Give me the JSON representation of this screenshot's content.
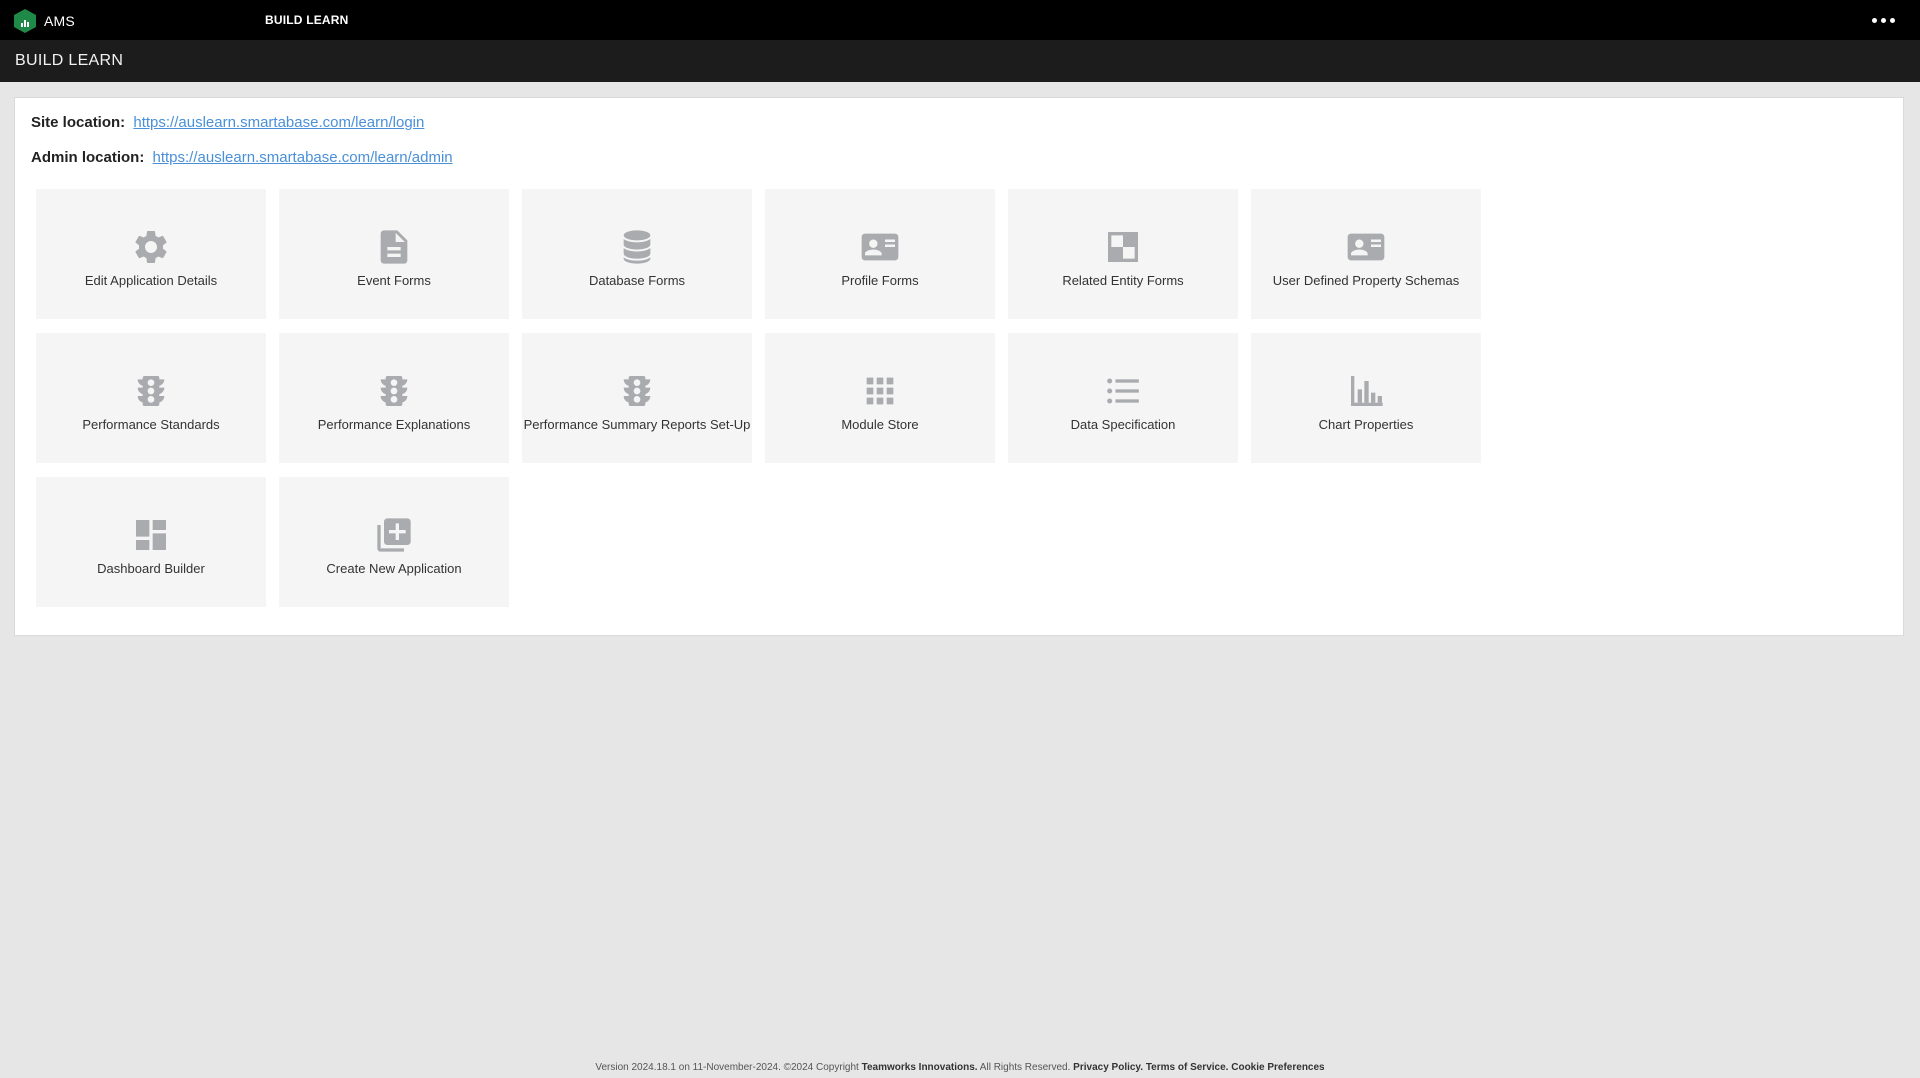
{
  "app": {
    "brand_name": "AMS",
    "top_title": "BUILD LEARN",
    "more_icon": "more-horizontal-icon"
  },
  "subheader": {
    "title": "BUILD LEARN"
  },
  "locations": {
    "site_label": "Site location:",
    "site_url": "https://auslearn.smartabase.com/learn/login",
    "admin_label": "Admin location:",
    "admin_url": "https://auslearn.smartabase.com/learn/admin"
  },
  "tiles": [
    {
      "label": "Edit Application Details",
      "icon": "gear-icon"
    },
    {
      "label": "Event Forms",
      "icon": "document-icon"
    },
    {
      "label": "Database Forms",
      "icon": "database-icon"
    },
    {
      "label": "Profile Forms",
      "icon": "id-card-icon"
    },
    {
      "label": "Related Entity Forms",
      "icon": "checker-icon"
    },
    {
      "label": "User Defined Property Schemas",
      "icon": "id-card-icon"
    },
    {
      "label": "Performance Standards",
      "icon": "traffic-light-icon"
    },
    {
      "label": "Performance Explanations",
      "icon": "traffic-light-icon"
    },
    {
      "label": "Performance Summary Reports Set-Up",
      "icon": "traffic-light-icon"
    },
    {
      "label": "Module Store",
      "icon": "grid-icon"
    },
    {
      "label": "Data Specification",
      "icon": "list-icon"
    },
    {
      "label": "Chart Properties",
      "icon": "bar-chart-icon"
    },
    {
      "label": "Dashboard Builder",
      "icon": "dashboard-icon"
    },
    {
      "label": "Create New Application",
      "icon": "add-library-icon"
    }
  ],
  "footer": {
    "version_text": "Version 2024.18.1 on 11-November-2024. ©2024 Copyright",
    "company": "Teamworks Innovations.",
    "rights": "All Rights Reserved.",
    "privacy": "Privacy Policy.",
    "terms": "Terms of Service.",
    "cookies": "Cookie Preferences"
  },
  "colors": {
    "topbar": "#000000",
    "subheader": "#1c1c1c",
    "background": "#e6e6e6",
    "tile": "#f5f5f5",
    "icon": "#a9abae",
    "link": "#4a90d9",
    "brand": "#1f8a47"
  }
}
